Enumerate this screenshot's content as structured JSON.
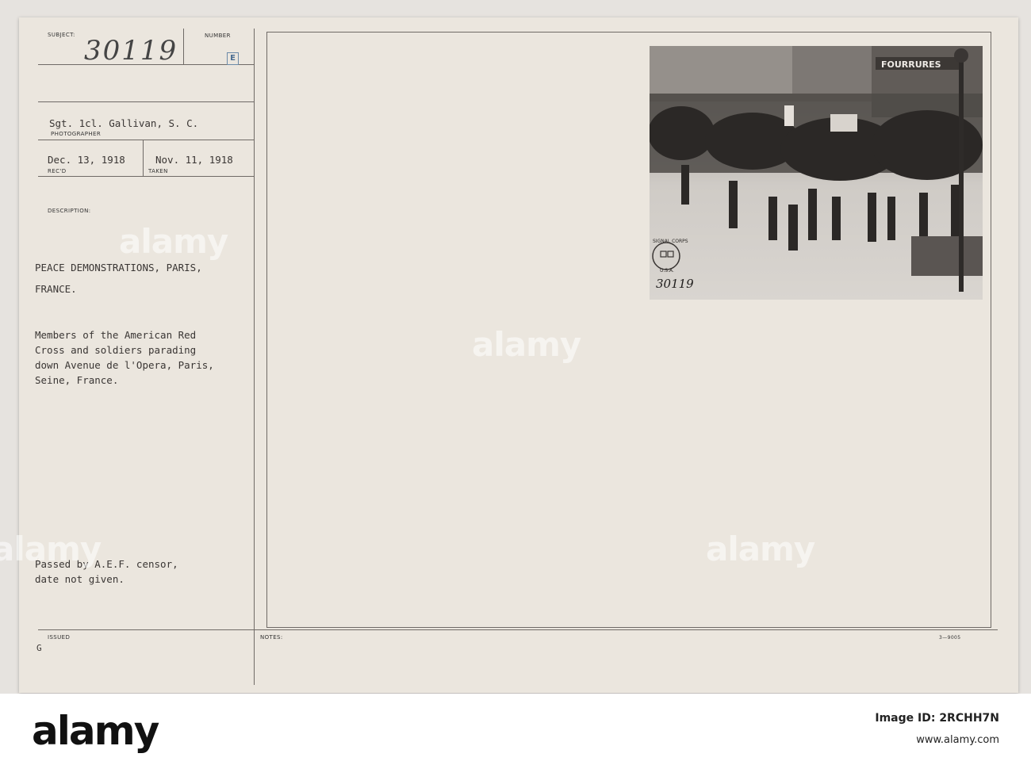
{
  "card": {
    "labels": {
      "subject": "SUBJECT:",
      "number": "NUMBER",
      "photographer": "PHOTOGRAPHER",
      "recd": "REC'D",
      "taken": "TAKEN",
      "description": "DESCRIPTION:",
      "issued": "ISSUED",
      "notes": "NOTES:"
    },
    "subject_number": "30119",
    "number_stamp": "E",
    "photographer": "Sgt. 1cl. Gallivan, S. C.",
    "received_date": "Dec. 13, 1918",
    "taken_date": "Nov. 11, 1918",
    "title_lines": [
      "PEACE DEMONSTRATIONS, PARIS,",
      "FRANCE."
    ],
    "body_lines": [
      "Members of the American Red",
      "Cross and soldiers parading",
      "down Avenue de l'Opera, Paris,",
      "Seine, France."
    ],
    "censor_lines": [
      "Passed by A.E.F. censor,",
      "date not given."
    ],
    "issued_value": "G",
    "form_code": "3—9005"
  },
  "photo": {
    "storefront_sign": "FOURRURES",
    "stamp_text": "SIGNAL CORPS",
    "stamp_sub": "U.S.A.",
    "handwritten_number": "30119"
  },
  "watermark": {
    "text": "alamy"
  },
  "footer": {
    "logo": "alamy",
    "image_id_label": "Image ID: 2RCHH7N",
    "site": "www.alamy.com"
  }
}
